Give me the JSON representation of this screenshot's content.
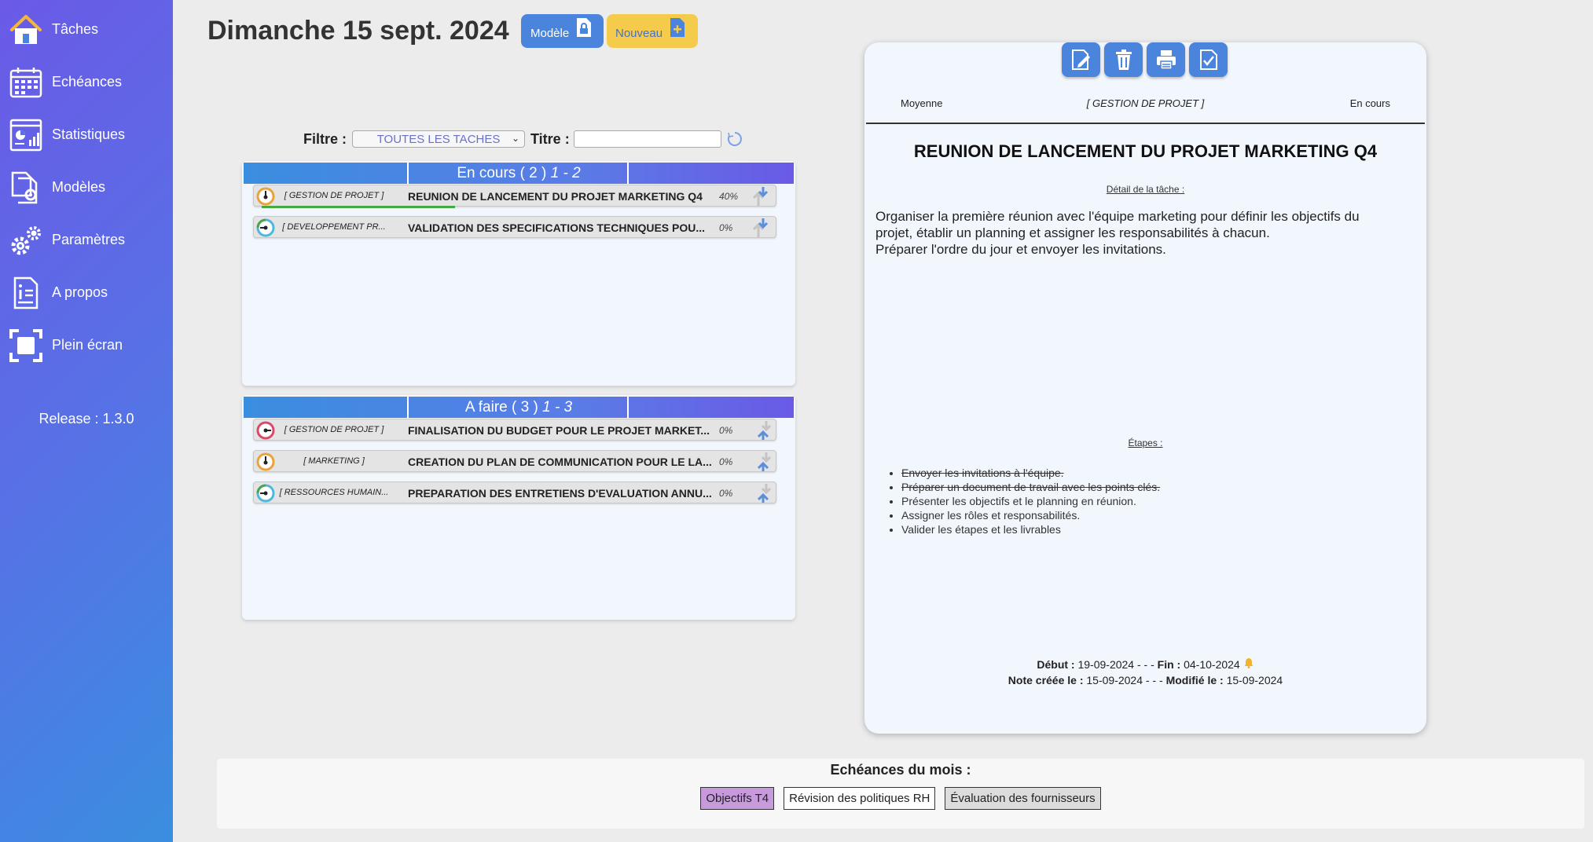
{
  "sidebar": {
    "items": [
      {
        "label": "Tâches",
        "icon": "home-icon"
      },
      {
        "label": "Echéances",
        "icon": "calendar-icon"
      },
      {
        "label": "Statistiques",
        "icon": "statistics-icon"
      },
      {
        "label": "Modèles",
        "icon": "templates-icon"
      },
      {
        "label": "Paramètres",
        "icon": "gears-icon"
      },
      {
        "label": "A propos",
        "icon": "info-document-icon"
      },
      {
        "label": "Plein écran",
        "icon": "fullscreen-icon"
      }
    ],
    "release": "Release : 1.3.0"
  },
  "header": {
    "date": "Dimanche 15 sept. 2024",
    "modele_label": "Modèle",
    "nouveau_label": "Nouveau"
  },
  "filter": {
    "filtre_label": "Filtre :",
    "filtre_value": "TOUTES LES TACHES",
    "titre_label": "Titre :",
    "titre_value": ""
  },
  "panels": {
    "en_cours": {
      "label": "En cours",
      "count": "( 2 )",
      "range": "1 - 2",
      "tasks": [
        {
          "priority": "medium",
          "category": "[ GESTION DE PROJET ]",
          "title": "REUNION DE LANCEMENT DU PROJET MARKETING Q4",
          "percent": "40%",
          "progress": 0.4
        },
        {
          "priority": "low",
          "category": "[ DEVELOPPEMENT PR...",
          "title": "VALIDATION DES SPECIFICATIONS TECHNIQUES POU...",
          "percent": "0%",
          "progress": 0
        }
      ]
    },
    "a_faire": {
      "label": "A faire",
      "count": "( 3 )",
      "range": "1 - 3",
      "tasks": [
        {
          "priority": "high",
          "category": "[ GESTION DE PROJET ]",
          "title": "FINALISATION DU BUDGET POUR LE PROJET MARKET...",
          "percent": "0%",
          "progress": 0
        },
        {
          "priority": "medium",
          "category": "[ MARKETING ]",
          "title": "CREATION DU PLAN DE COMMUNICATION POUR LE LA...",
          "percent": "0%",
          "progress": 0
        },
        {
          "priority": "low",
          "category": "[ RESSOURCES HUMAIN...",
          "title": "PREPARATION DES ENTRETIENS D'EVALUATION ANNU...",
          "percent": "0%",
          "progress": 0
        }
      ]
    }
  },
  "detail": {
    "priority": "Moyenne",
    "category": "[ GESTION DE PROJET ]",
    "status": "En cours",
    "title": "REUNION DE LANCEMENT DU PROJET MARKETING Q4",
    "detail_label": "Détail de la tâche :",
    "description_lines": [
      "Organiser la première réunion avec l'équipe marketing pour définir les objectifs du",
      "projet, établir un planning et assigner les responsabilités à chacun.",
      "Préparer l'ordre du jour et envoyer les invitations."
    ],
    "steps_label": "Étapes :",
    "steps": [
      {
        "text": "Envoyer les invitations à l'équipe.",
        "done": true
      },
      {
        "text": "Préparer un document de travail avec les points clés.",
        "done": true
      },
      {
        "text": "Présenter les objectifs et le planning en réunion.",
        "done": false
      },
      {
        "text": "Assigner les rôles et responsabilités.",
        "done": false
      },
      {
        "text": "Valider les étapes et les livrables",
        "done": false
      }
    ],
    "debut_label": "Début :",
    "debut": "19-09-2024",
    "separator": "- - -",
    "fin_label": "Fin :",
    "fin": "04-10-2024",
    "created_label": "Note créée le :",
    "created": "15-09-2024",
    "modified_label": "Modifié le :",
    "modified": "15-09-2024"
  },
  "echeances": {
    "title": "Echéances du mois :",
    "items": [
      {
        "label": "Objectifs T4",
        "color": "#c79bdb"
      },
      {
        "label": "Révision des politiques RH",
        "color": "#ffffff"
      },
      {
        "label": "Évaluation des fournisseurs",
        "color": "#dcdcdc"
      }
    ]
  },
  "colors": {
    "accent_blue": "#4a84dc",
    "accent_yellow": "#f4cb4a",
    "gradient_start": "#6a5ae6",
    "gradient_end": "#3a8ee0",
    "progress": "#45a845"
  }
}
